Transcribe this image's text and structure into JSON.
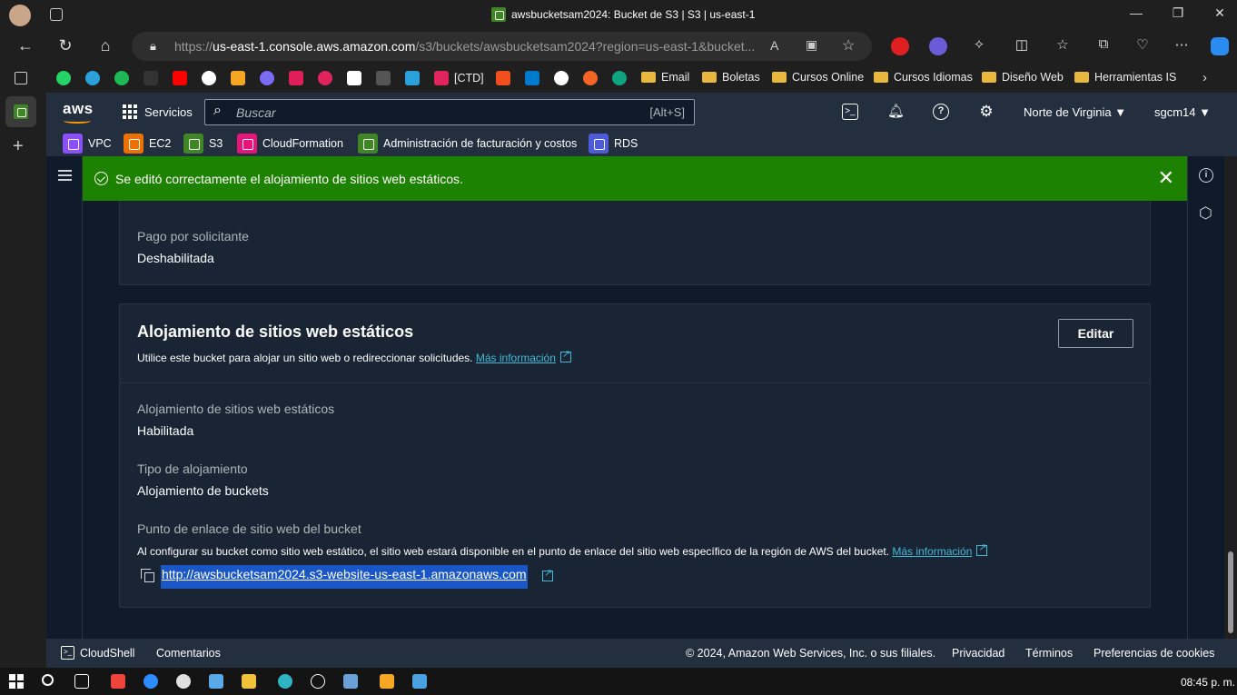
{
  "browser": {
    "tab_title": "awsbucketsam2024: Bucket de S3 | S3 | us-east-1",
    "url_prefix": "https://",
    "url_domain": "us-east-1.console.aws.amazon.com",
    "url_path": "/s3/buckets/awsbucketsam2024?region=us-east-1&bucket..."
  },
  "bookmarks": {
    "ctd": "[CTD]",
    "folders": [
      "Email",
      "Boletas",
      "Cursos Online",
      "Cursos Idiomas",
      "Diseño Web",
      "Herramientas IS"
    ]
  },
  "aws_header": {
    "logo": "aws",
    "services": "Servicios",
    "search_placeholder": "Buscar",
    "search_shortcut": "[Alt+S]",
    "region": "Norte de Virginia ▼",
    "user": "sgcm14 ▼"
  },
  "favorites": [
    "VPC",
    "EC2",
    "S3",
    "CloudFormation",
    "Administración de facturación y costos",
    "RDS"
  ],
  "flash": {
    "message": "Se editó correctamente el alojamiento de sitios web estáticos.",
    "close": "✕"
  },
  "requester_pays": {
    "label": "Pago por solicitante",
    "value": "Deshabilitada"
  },
  "static_hosting": {
    "title": "Alojamiento de sitios web estáticos",
    "description": "Utilice este bucket para alojar un sitio web o redireccionar solicitudes.",
    "more_info": "Más información",
    "edit_button": "Editar",
    "hosting_label": "Alojamiento de sitios web estáticos",
    "hosting_value": "Habilitada",
    "type_label": "Tipo de alojamiento",
    "type_value": "Alojamiento de buckets",
    "endpoint_label": "Punto de enlace de sitio web del bucket",
    "endpoint_description": "Al configurar su bucket como sitio web estático, el sitio web estará disponible en el punto de enlace del sitio web específico de la región de AWS del bucket.",
    "endpoint_more_info": "Más información",
    "endpoint_url": "http://awsbucketsam2024.s3-website-us-east-1.amazonaws.com"
  },
  "footer": {
    "cloudshell": "CloudShell",
    "feedback": "Comentarios",
    "copyright": "© 2024, Amazon Web Services, Inc. o sus filiales.",
    "privacy": "Privacidad",
    "terms": "Términos",
    "cookies": "Preferencias de cookies"
  },
  "taskbar": {
    "time": "08:45 p. m."
  },
  "colors": {
    "success_green": "#1d8102",
    "aws_nav": "#232f3e",
    "content_bg": "#0f1b2a",
    "link": "#44b9d6",
    "aws_orange": "#ff9900"
  }
}
